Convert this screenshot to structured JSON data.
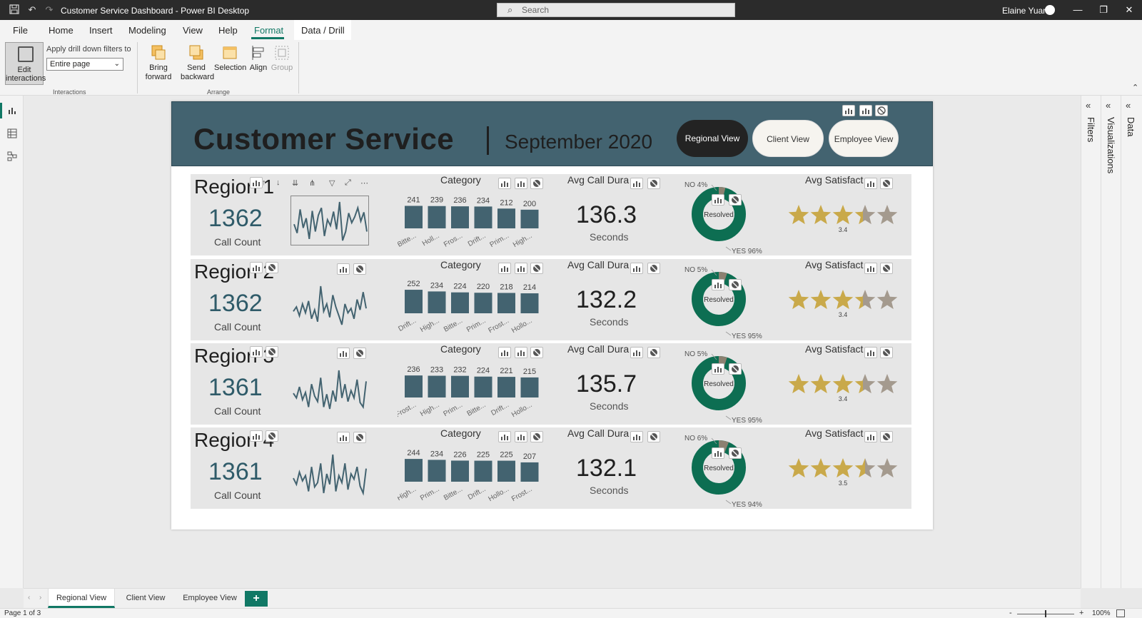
{
  "window": {
    "title": "Customer Service Dashboard - Power BI Desktop",
    "search_placeholder": "Search",
    "user_name": "Elaine Yuan"
  },
  "menu": {
    "items": [
      "File",
      "Home",
      "Insert",
      "Modeling",
      "View",
      "Help",
      "Format",
      "Data / Drill"
    ],
    "active": "Format"
  },
  "ribbon": {
    "edit_interactions_label": "Edit interactions",
    "drill_filter_label": "Apply drill down filters to",
    "drill_filter_value": "Entire page",
    "interactions_group": "Interactions",
    "arrange_group": "Arrange",
    "buttons": {
      "bring_forward": "Bring forward",
      "send_backward": "Send backward",
      "selection": "Selection",
      "align": "Align",
      "group": "Group"
    }
  },
  "side_panes": {
    "filters": "Filters",
    "visualizations": "Visualizations",
    "data": "Data"
  },
  "report": {
    "title": "Customer Service",
    "subtitle": "September 2020",
    "views": [
      "Regional View",
      "Client View",
      "Employee View"
    ],
    "active_view": "Regional View",
    "call_count_label": "Call Count",
    "category_title": "Category",
    "avg_call_title": "Avg Call Dura",
    "avg_call_unit": "Seconds",
    "avg_sat_title": "Avg Satisfact",
    "resolved_label": "Resolved",
    "colors": {
      "header": "#436370",
      "bar": "#436370",
      "donut_yes": "#0d6e52",
      "donut_no": "#8c8171",
      "star_gold": "#c9a94a",
      "star_grey": "#a49a8e"
    },
    "regions": [
      {
        "name": "Region 1",
        "call_count": "1362",
        "avg_call": "136.3",
        "no_label": "NO 4%",
        "yes_label": "YES 96%",
        "no_pct": 4,
        "satisfaction": 3.4,
        "sat_label": "3.4",
        "sparkline": [
          40,
          28,
          60,
          35,
          48,
          20,
          58,
          30,
          52,
          62,
          24,
          46,
          38,
          57,
          33,
          70,
          18,
          30,
          55,
          42,
          50,
          62,
          44,
          56,
          30
        ],
        "categories": [
          "Bitte...",
          "Holl...",
          "Fros...",
          "Drift...",
          "Prim...",
          "High..."
        ],
        "values": [
          241,
          239,
          236,
          234,
          212,
          200
        ]
      },
      {
        "name": "Region 2",
        "call_count": "1362",
        "avg_call": "132.2",
        "no_label": "NO 5%",
        "yes_label": "YES 95%",
        "no_pct": 5,
        "satisfaction": 3.4,
        "sat_label": "3.4",
        "sparkline": [
          45,
          48,
          42,
          50,
          44,
          52,
          40,
          46,
          38,
          62,
          45,
          50,
          41,
          56,
          48,
          42,
          36,
          50,
          44,
          47,
          40,
          53,
          46,
          58,
          47
        ],
        "categories": [
          "Drift...",
          "High...",
          "Bitte...",
          "Prim...",
          "Frost...",
          "Hollo..."
        ],
        "values": [
          252,
          234,
          224,
          220,
          218,
          214
        ]
      },
      {
        "name": "Region 3",
        "call_count": "1361",
        "avg_call": "135.7",
        "no_label": "NO 5%",
        "yes_label": "YES 95%",
        "no_pct": 5,
        "satisfaction": 3.4,
        "sat_label": "3.4",
        "sparkline": [
          45,
          40,
          52,
          38,
          46,
          30,
          55,
          42,
          36,
          62,
          30,
          44,
          28,
          48,
          36,
          70,
          40,
          55,
          36,
          48,
          40,
          60,
          35,
          30,
          58
        ],
        "categories": [
          "Frost...",
          "High...",
          "Prim...",
          "Bitte...",
          "Drift...",
          "Hollo..."
        ],
        "values": [
          236,
          233,
          232,
          224,
          221,
          215
        ]
      },
      {
        "name": "Region 4",
        "call_count": "1361",
        "avg_call": "132.1",
        "no_label": "NO 6%",
        "yes_label": "YES 94%",
        "no_pct": 6,
        "satisfaction": 3.5,
        "sat_label": "3.5",
        "sparkline": [
          45,
          38,
          52,
          42,
          48,
          30,
          58,
          35,
          40,
          62,
          28,
          50,
          38,
          72,
          30,
          48,
          40,
          62,
          32,
          50,
          44,
          58,
          36,
          28,
          56
        ],
        "categories": [
          "High...",
          "Prim...",
          "Bitte...",
          "Drift...",
          "Hollo...",
          "Frost..."
        ],
        "values": [
          244,
          234,
          226,
          225,
          225,
          207
        ]
      }
    ]
  },
  "pages": {
    "tabs": [
      "Regional View",
      "Client View",
      "Employee View"
    ],
    "active": "Regional View",
    "status": "Page 1 of 3",
    "zoom": "100%"
  },
  "chart_data": [
    {
      "type": "bar",
      "title": "Category",
      "categories": [
        "Bitte...",
        "Holl...",
        "Fros...",
        "Drift...",
        "Prim...",
        "High..."
      ],
      "values": [
        241,
        239,
        236,
        234,
        212,
        200
      ]
    },
    {
      "type": "bar",
      "title": "Category",
      "categories": [
        "Drift...",
        "High...",
        "Bitte...",
        "Prim...",
        "Frost...",
        "Hollo..."
      ],
      "values": [
        252,
        234,
        224,
        220,
        218,
        214
      ]
    },
    {
      "type": "bar",
      "title": "Category",
      "categories": [
        "Frost...",
        "High...",
        "Prim...",
        "Bitte...",
        "Drift...",
        "Hollo..."
      ],
      "values": [
        236,
        233,
        232,
        224,
        221,
        215
      ]
    },
    {
      "type": "bar",
      "title": "Category",
      "categories": [
        "High...",
        "Prim...",
        "Bitte...",
        "Drift...",
        "Hollo...",
        "Frost..."
      ],
      "values": [
        244,
        234,
        226,
        225,
        225,
        207
      ]
    },
    {
      "type": "pie",
      "title": "",
      "categories": [
        "NO",
        "YES"
      ],
      "values": [
        4,
        96
      ]
    },
    {
      "type": "pie",
      "title": "",
      "categories": [
        "NO",
        "YES"
      ],
      "values": [
        5,
        95
      ]
    },
    {
      "type": "pie",
      "title": "",
      "categories": [
        "NO",
        "YES"
      ],
      "values": [
        5,
        95
      ]
    },
    {
      "type": "pie",
      "title": "",
      "categories": [
        "NO",
        "YES"
      ],
      "values": [
        6,
        94
      ]
    }
  ]
}
